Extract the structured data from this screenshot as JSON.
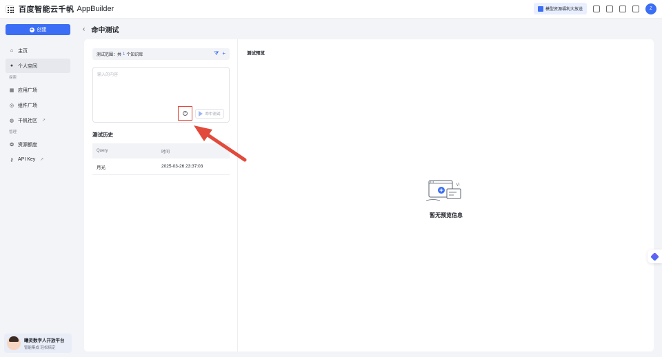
{
  "header": {
    "logo_cn": "百度智能云千帆",
    "logo_en": "AppBuilder",
    "promo_label": "模型资源福利大放送",
    "avatar_letter": "Z"
  },
  "sidebar": {
    "create_label": "创建",
    "items": [
      {
        "label": "主页",
        "icon": "home-icon"
      },
      {
        "label": "个人空间",
        "icon": "user-icon"
      },
      {
        "section": "探索"
      },
      {
        "label": "应用广场",
        "icon": "apps-icon"
      },
      {
        "label": "组件广场",
        "icon": "component-icon"
      },
      {
        "label": "千帆社区",
        "icon": "community-icon"
      },
      {
        "section": "管理"
      },
      {
        "label": "资源额度",
        "icon": "resource-icon"
      },
      {
        "label": "API Key",
        "icon": "key-icon"
      }
    ],
    "promo_card": {
      "title": "曦灵数字人开放平台",
      "subtitle": "智能集成 轻松搞定"
    }
  },
  "main": {
    "title": "命中测试",
    "scope": {
      "prefix": "测试范围：共",
      "count": "1",
      "suffix": "个知识库"
    },
    "query_placeholder": "输入的内容",
    "hit_test_label": "命中测试",
    "history_title": "测试历史",
    "history_columns": [
      "Query",
      "时间"
    ],
    "history_rows": [
      {
        "query": "月光",
        "time": "2025-03-26 23:37:03"
      }
    ],
    "preview_label": "测试预览",
    "empty_text": "暂无预览信息"
  },
  "colors": {
    "accent": "#3b6ef5",
    "annotation_red": "#e24a3b"
  }
}
